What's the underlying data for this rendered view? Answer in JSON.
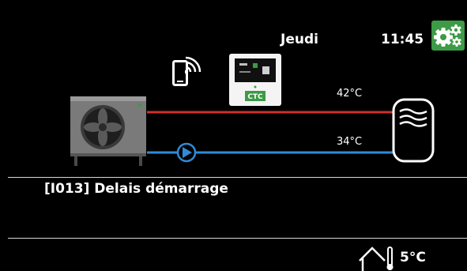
{
  "header": {
    "day": "Jeudi",
    "time": "11:45"
  },
  "icons": {
    "settings": "gear-icon",
    "remote": "phone-wifi-icon",
    "controller": "ctc-controller-icon",
    "heat_pump": "heat-pump-icon",
    "tank": "water-tank-icon",
    "pump": "circulation-pump-icon",
    "house": "house-thermometer-icon"
  },
  "controller": {
    "brand": "CTC"
  },
  "circuit": {
    "supply_temp": "42°C",
    "return_temp": "34°C",
    "supply_color": "#d0312d",
    "return_color": "#2f8ad8"
  },
  "alarm": {
    "message": "[I013] Delais démarrage"
  },
  "footer": {
    "outdoor_temp": "5°C"
  },
  "colors": {
    "accent": "#3d9a46",
    "background": "#000000"
  }
}
